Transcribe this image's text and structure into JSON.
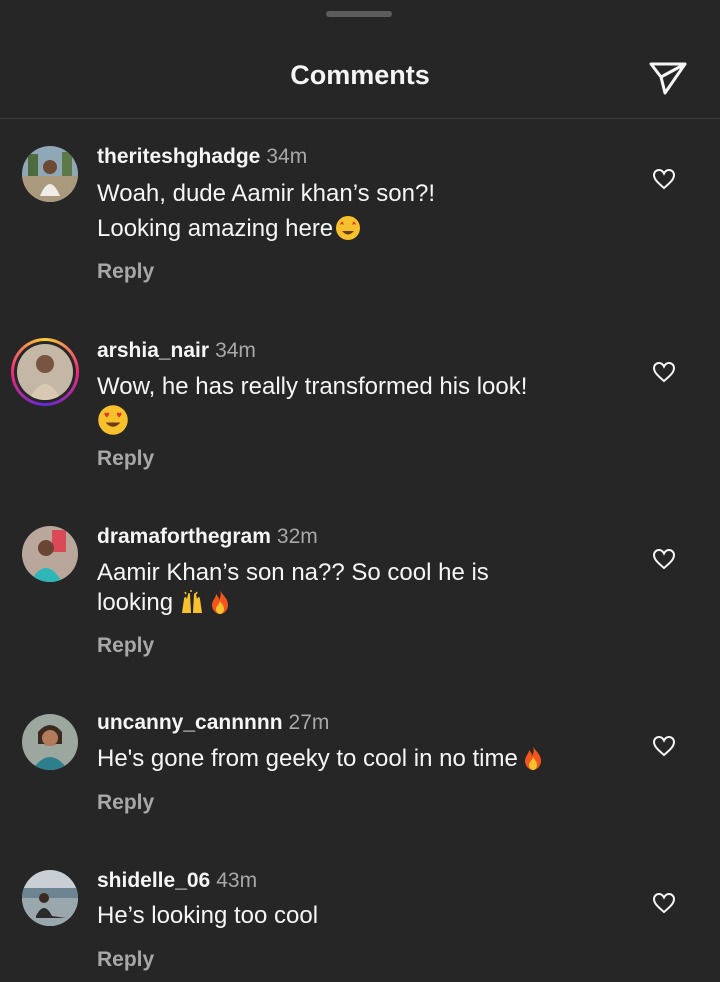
{
  "header": {
    "title": "Comments",
    "share_icon": "paper-plane-icon"
  },
  "comments": [
    {
      "username": "theriteshghadge",
      "time": "34m",
      "text_line1": "Woah, dude Aamir khan’s son?!",
      "text_line2": "Looking amazing here",
      "emojis": [
        "star-struck-emoji"
      ],
      "reply": "Reply",
      "story_ring": false
    },
    {
      "username": "arshia_nair",
      "time": "34m",
      "text_line1": "Wow, he has really transformed his look!",
      "emojis": [
        "heart-eyes-emoji"
      ],
      "reply": "Reply",
      "story_ring": true
    },
    {
      "username": "dramaforthegram",
      "time": "32m",
      "text_line1": "Aamir Khan’s son na?? So cool he is",
      "text_line2": "looking",
      "emojis": [
        "raising-hands-emoji",
        "fire-emoji"
      ],
      "reply": "Reply",
      "story_ring": false
    },
    {
      "username": "uncanny_cannnnn",
      "time": "27m",
      "text_line1": "He's gone from geeky to cool in no time",
      "emojis": [
        "fire-emoji"
      ],
      "reply": "Reply",
      "story_ring": false
    },
    {
      "username": "shidelle_06",
      "time": "43m",
      "text_line1": "He’s looking too cool",
      "reply": "Reply",
      "story_ring": false
    }
  ],
  "colors": {
    "background": "#262626",
    "primary_text": "#f5f5f5",
    "secondary_text": "#a8a8a8",
    "story_ring": [
      "#f9ce34",
      "#ee2a7b",
      "#6228d7"
    ]
  }
}
